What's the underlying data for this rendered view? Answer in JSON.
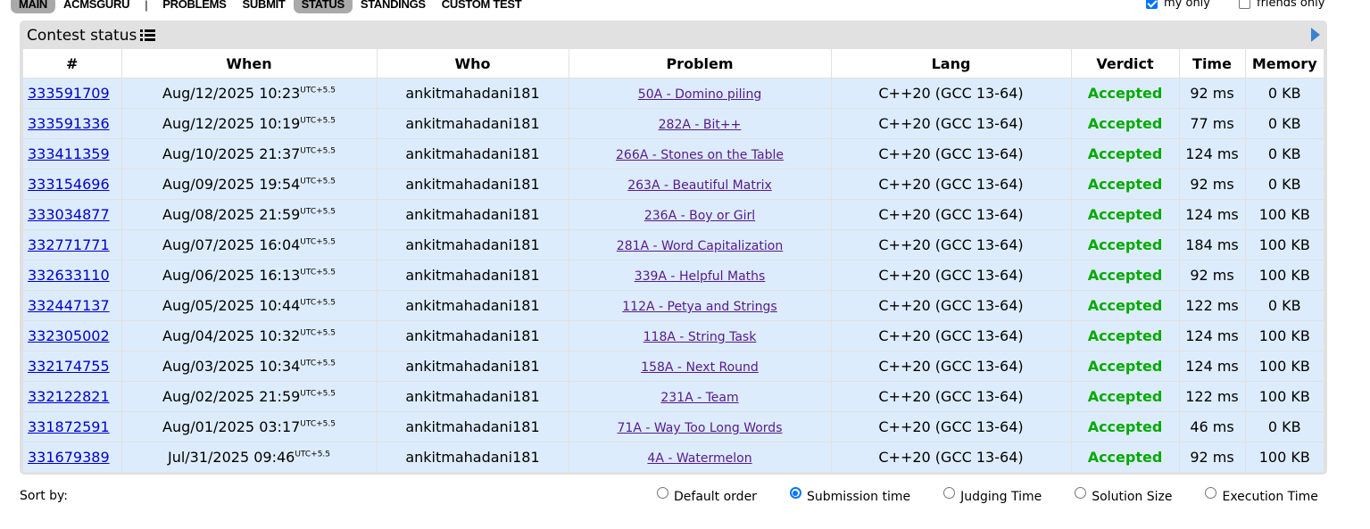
{
  "nav": {
    "items": [
      {
        "label": "MAIN",
        "active": true
      },
      {
        "label": "ACMSGURU",
        "active": false
      },
      {
        "label": "PROBLEMS",
        "active": false
      },
      {
        "label": "SUBMIT",
        "active": false
      },
      {
        "label": "STATUS",
        "active": true
      },
      {
        "label": "STANDINGS",
        "active": false
      },
      {
        "label": "CUSTOM TEST",
        "active": false
      }
    ],
    "separator": "|"
  },
  "filters": {
    "my_only_label": "my only",
    "my_only_checked": true,
    "friends_only_label": "friends only",
    "friends_only_checked": false
  },
  "panel": {
    "title": "Contest status",
    "title_icon": "list-icon",
    "next_icon": "play-icon"
  },
  "table": {
    "headers": [
      "#",
      "When",
      "Who",
      "Problem",
      "Lang",
      "Verdict",
      "Time",
      "Memory"
    ],
    "tz_suffix": "UTC+5.5",
    "rows": [
      {
        "id": "333591709",
        "when": "Aug/12/2025 10:23",
        "who": "ankitmahadani181",
        "problem": "50A - Domino piling",
        "lang": "C++20 (GCC 13-64)",
        "verdict": "Accepted",
        "time": "92 ms",
        "memory": "0 KB"
      },
      {
        "id": "333591336",
        "when": "Aug/12/2025 10:19",
        "who": "ankitmahadani181",
        "problem": "282A - Bit++",
        "lang": "C++20 (GCC 13-64)",
        "verdict": "Accepted",
        "time": "77 ms",
        "memory": "0 KB"
      },
      {
        "id": "333411359",
        "when": "Aug/10/2025 21:37",
        "who": "ankitmahadani181",
        "problem": "266A - Stones on the Table",
        "lang": "C++20 (GCC 13-64)",
        "verdict": "Accepted",
        "time": "124 ms",
        "memory": "0 KB"
      },
      {
        "id": "333154696",
        "when": "Aug/09/2025 19:54",
        "who": "ankitmahadani181",
        "problem": "263A - Beautiful Matrix",
        "lang": "C++20 (GCC 13-64)",
        "verdict": "Accepted",
        "time": "92 ms",
        "memory": "0 KB"
      },
      {
        "id": "333034877",
        "when": "Aug/08/2025 21:59",
        "who": "ankitmahadani181",
        "problem": "236A - Boy or Girl",
        "lang": "C++20 (GCC 13-64)",
        "verdict": "Accepted",
        "time": "124 ms",
        "memory": "100 KB"
      },
      {
        "id": "332771771",
        "when": "Aug/07/2025 16:04",
        "who": "ankitmahadani181",
        "problem": "281A - Word Capitalization",
        "lang": "C++20 (GCC 13-64)",
        "verdict": "Accepted",
        "time": "184 ms",
        "memory": "100 KB"
      },
      {
        "id": "332633110",
        "when": "Aug/06/2025 16:13",
        "who": "ankitmahadani181",
        "problem": "339A - Helpful Maths",
        "lang": "C++20 (GCC 13-64)",
        "verdict": "Accepted",
        "time": "92 ms",
        "memory": "100 KB"
      },
      {
        "id": "332447137",
        "when": "Aug/05/2025 10:44",
        "who": "ankitmahadani181",
        "problem": "112A - Petya and Strings",
        "lang": "C++20 (GCC 13-64)",
        "verdict": "Accepted",
        "time": "122 ms",
        "memory": "0 KB"
      },
      {
        "id": "332305002",
        "when": "Aug/04/2025 10:32",
        "who": "ankitmahadani181",
        "problem": "118A - String Task",
        "lang": "C++20 (GCC 13-64)",
        "verdict": "Accepted",
        "time": "124 ms",
        "memory": "100 KB"
      },
      {
        "id": "332174755",
        "when": "Aug/03/2025 10:34",
        "who": "ankitmahadani181",
        "problem": "158A - Next Round",
        "lang": "C++20 (GCC 13-64)",
        "verdict": "Accepted",
        "time": "124 ms",
        "memory": "100 KB"
      },
      {
        "id": "332122821",
        "when": "Aug/02/2025 21:59",
        "who": "ankitmahadani181",
        "problem": "231A - Team",
        "lang": "C++20 (GCC 13-64)",
        "verdict": "Accepted",
        "time": "122 ms",
        "memory": "100 KB"
      },
      {
        "id": "331872591",
        "when": "Aug/01/2025 03:17",
        "who": "ankitmahadani181",
        "problem": "71A - Way Too Long Words",
        "lang": "C++20 (GCC 13-64)",
        "verdict": "Accepted",
        "time": "46 ms",
        "memory": "0 KB"
      },
      {
        "id": "331679389",
        "when": "Jul/31/2025 09:46",
        "who": "ankitmahadani181",
        "problem": "4A - Watermelon",
        "lang": "C++20 (GCC 13-64)",
        "verdict": "Accepted",
        "time": "92 ms",
        "memory": "100 KB"
      }
    ]
  },
  "sort": {
    "label": "Sort by:",
    "options": [
      {
        "label": "Default order",
        "checked": false
      },
      {
        "label": "Submission time",
        "checked": true
      },
      {
        "label": "Judging Time",
        "checked": false
      },
      {
        "label": "Solution Size",
        "checked": false
      },
      {
        "label": "Execution Time",
        "checked": false
      }
    ]
  },
  "colors": {
    "accepted": "#00aa00",
    "row_bg": "#ddecfc",
    "panel_bg": "#e1e1e1",
    "link": "#0000cc",
    "problem_link": "#551a8b",
    "active_tab_bg": "#a9a9a9"
  }
}
